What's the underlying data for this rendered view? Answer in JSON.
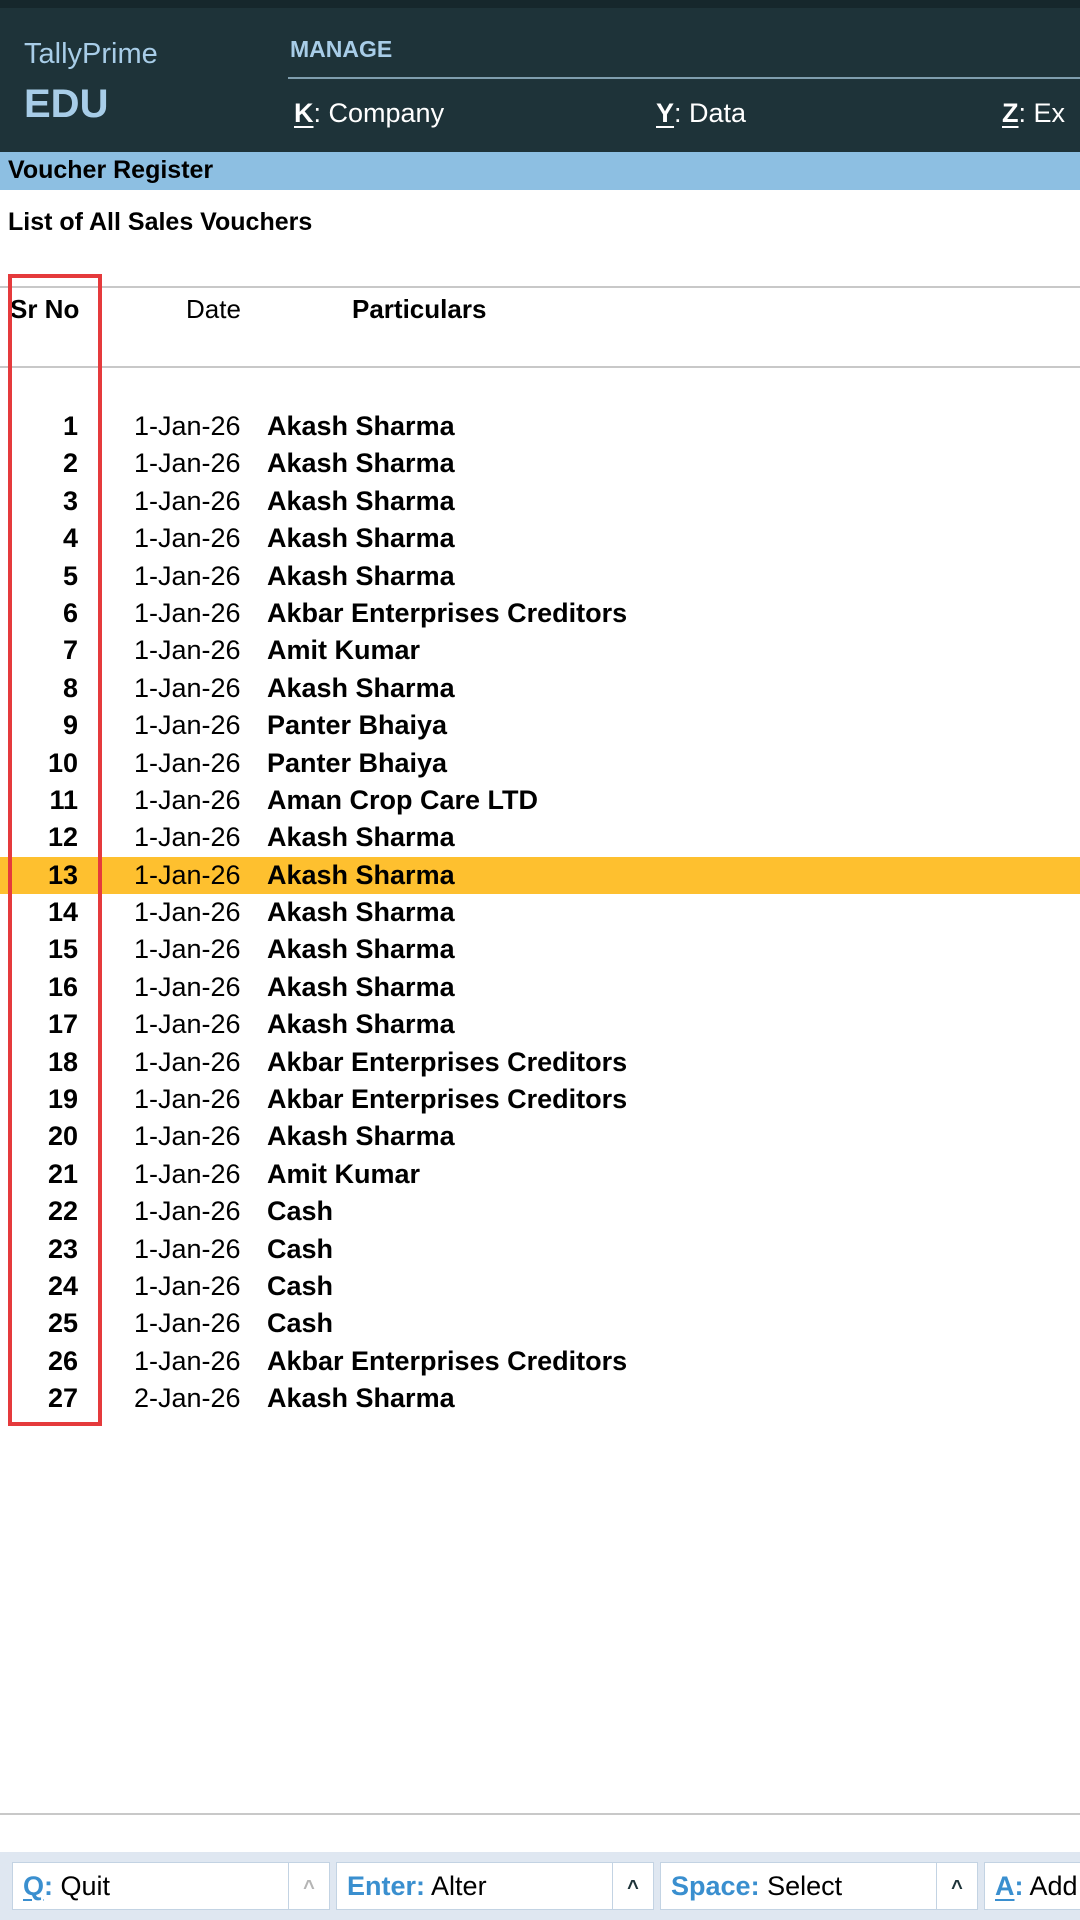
{
  "header": {
    "brand_name": "TallyPrime",
    "brand_edition": "EDU",
    "menu_section": "MANAGE",
    "menu": [
      {
        "key": "K",
        "sep": ":",
        "label": " Company"
      },
      {
        "key": "Y",
        "sep": ":",
        "label": " Data"
      },
      {
        "key": "Z",
        "sep": ":",
        "label": " Ex"
      }
    ]
  },
  "title_bar": {
    "title": "Voucher Register"
  },
  "report": {
    "subtitle": "List of All Sales Vouchers",
    "columns": {
      "sr_no": "Sr No",
      "date": "Date",
      "particulars": "Particulars"
    },
    "selected_row": 13,
    "rows": [
      {
        "sr": "1",
        "date": "1-Jan-26",
        "particulars": "Akash Sharma"
      },
      {
        "sr": "2",
        "date": "1-Jan-26",
        "particulars": "Akash Sharma"
      },
      {
        "sr": "3",
        "date": "1-Jan-26",
        "particulars": "Akash Sharma"
      },
      {
        "sr": "4",
        "date": "1-Jan-26",
        "particulars": "Akash Sharma"
      },
      {
        "sr": "5",
        "date": "1-Jan-26",
        "particulars": "Akash Sharma"
      },
      {
        "sr": "6",
        "date": "1-Jan-26",
        "particulars": "Akbar Enterprises Creditors"
      },
      {
        "sr": "7",
        "date": "1-Jan-26",
        "particulars": "Amit Kumar"
      },
      {
        "sr": "8",
        "date": "1-Jan-26",
        "particulars": "Akash Sharma"
      },
      {
        "sr": "9",
        "date": "1-Jan-26",
        "particulars": "Panter Bhaiya"
      },
      {
        "sr": "10",
        "date": "1-Jan-26",
        "particulars": "Panter Bhaiya"
      },
      {
        "sr": "11",
        "date": "1-Jan-26",
        "particulars": "Aman Crop Care LTD"
      },
      {
        "sr": "12",
        "date": "1-Jan-26",
        "particulars": "Akash Sharma"
      },
      {
        "sr": "13",
        "date": "1-Jan-26",
        "particulars": "Akash Sharma"
      },
      {
        "sr": "14",
        "date": "1-Jan-26",
        "particulars": "Akash Sharma"
      },
      {
        "sr": "15",
        "date": "1-Jan-26",
        "particulars": "Akash Sharma"
      },
      {
        "sr": "16",
        "date": "1-Jan-26",
        "particulars": "Akash Sharma"
      },
      {
        "sr": "17",
        "date": "1-Jan-26",
        "particulars": "Akash Sharma"
      },
      {
        "sr": "18",
        "date": "1-Jan-26",
        "particulars": "Akbar Enterprises Creditors"
      },
      {
        "sr": "19",
        "date": "1-Jan-26",
        "particulars": "Akbar Enterprises Creditors"
      },
      {
        "sr": "20",
        "date": "1-Jan-26",
        "particulars": "Akash Sharma"
      },
      {
        "sr": "21",
        "date": "1-Jan-26",
        "particulars": "Amit Kumar"
      },
      {
        "sr": "22",
        "date": "1-Jan-26",
        "particulars": "Cash"
      },
      {
        "sr": "23",
        "date": "1-Jan-26",
        "particulars": "Cash"
      },
      {
        "sr": "24",
        "date": "1-Jan-26",
        "particulars": "Cash"
      },
      {
        "sr": "25",
        "date": "1-Jan-26",
        "particulars": "Cash"
      },
      {
        "sr": "26",
        "date": "1-Jan-26",
        "particulars": "Akbar Enterprises Creditors"
      },
      {
        "sr": "27",
        "date": "2-Jan-26",
        "particulars": "Akash Sharma"
      }
    ]
  },
  "buttons": [
    {
      "key": "Q",
      "sep": ":",
      "label": " Quit",
      "caret": "^"
    },
    {
      "key": "Enter",
      "sep": ":",
      "label": " Alter",
      "caret": "^"
    },
    {
      "key": "Space",
      "sep": ":",
      "label": " Select",
      "caret": "^"
    },
    {
      "key": "A",
      "sep": ":",
      "label": " Add",
      "caret": ""
    }
  ],
  "colors": {
    "header_bg": "#1e3339",
    "title_bar_bg": "#8dbfe2",
    "selected_row_bg": "#fec02f",
    "highlight_box": "#e53a3c",
    "button_key": "#3a8fcf"
  }
}
